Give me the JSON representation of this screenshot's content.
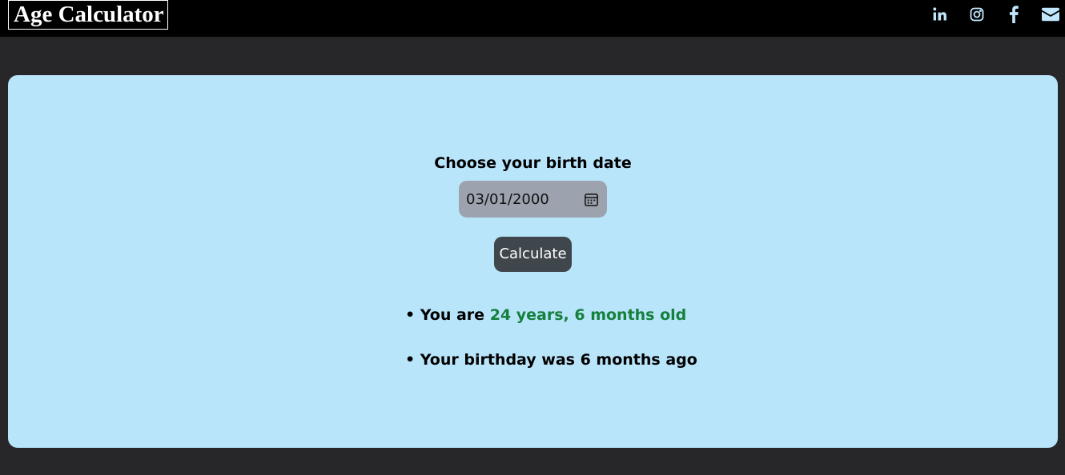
{
  "header": {
    "title": "Age Calculator",
    "social": [
      {
        "icon": "linkedin-icon"
      },
      {
        "icon": "instagram-icon"
      },
      {
        "icon": "facebook-icon"
      },
      {
        "icon": "mail-icon"
      }
    ]
  },
  "form": {
    "label": "Choose your birth date",
    "date_value": "03/01/2000",
    "calendar_icon": "calendar-icon",
    "button_label": "Calculate"
  },
  "results": {
    "bullet": "•",
    "age_prefix": "You are",
    "age_value": "24 years, 6 months old",
    "birthday_text": "Your birthday was 6 months ago"
  },
  "colors": {
    "page_bg": "#27272a",
    "header_bg": "#000000",
    "card_bg": "#b9e5fb",
    "input_bg": "#9ca3af",
    "button_bg": "#3f474d",
    "age_highlight": "#15803d",
    "icon_color": "#bfe6fb"
  }
}
